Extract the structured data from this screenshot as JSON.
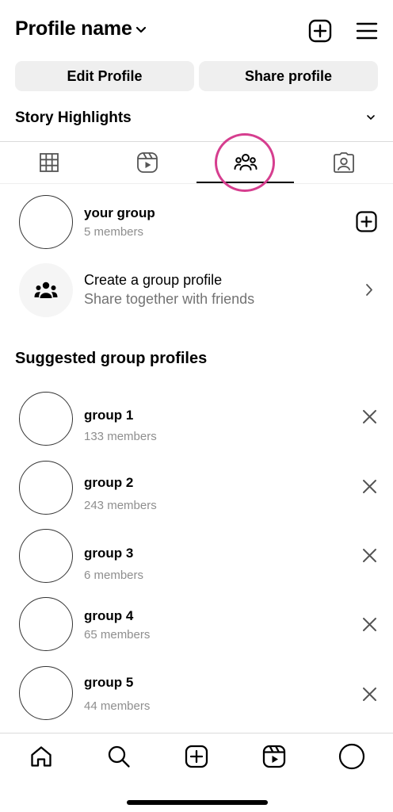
{
  "header": {
    "profile_name": "Profile name",
    "icons": [
      "chevron-down-icon",
      "add-post-icon",
      "menu-icon"
    ]
  },
  "actions": {
    "edit_profile": "Edit Profile",
    "share_profile": "Share profile"
  },
  "story_highlights": {
    "label": "Story Highlights"
  },
  "tabs": [
    {
      "name": "grid-icon",
      "selected": false
    },
    {
      "name": "reels-icon",
      "selected": false
    },
    {
      "name": "groups-icon",
      "selected": true
    },
    {
      "name": "tagged-icon",
      "selected": false
    }
  ],
  "your_group": {
    "name": "your group",
    "members": "5 members"
  },
  "create_group": {
    "title": "Create a group profile",
    "subtitle": "Share together with friends"
  },
  "suggested": {
    "title": "Suggested group profiles",
    "items": [
      {
        "name": "group 1",
        "members": "133 members"
      },
      {
        "name": "group 2",
        "members": "243 members"
      },
      {
        "name": "group 3",
        "members": "6 members"
      },
      {
        "name": "group 4",
        "members": "65 members"
      },
      {
        "name": "group 5",
        "members": "44 members"
      }
    ]
  },
  "bottom_nav": [
    "home-icon",
    "search-icon",
    "create-icon",
    "reels-icon",
    "profile-avatar-icon"
  ],
  "colors": {
    "highlight_ring": "#d63e8f",
    "button_bg": "#efefef",
    "secondary_text": "#8e8e8e"
  }
}
